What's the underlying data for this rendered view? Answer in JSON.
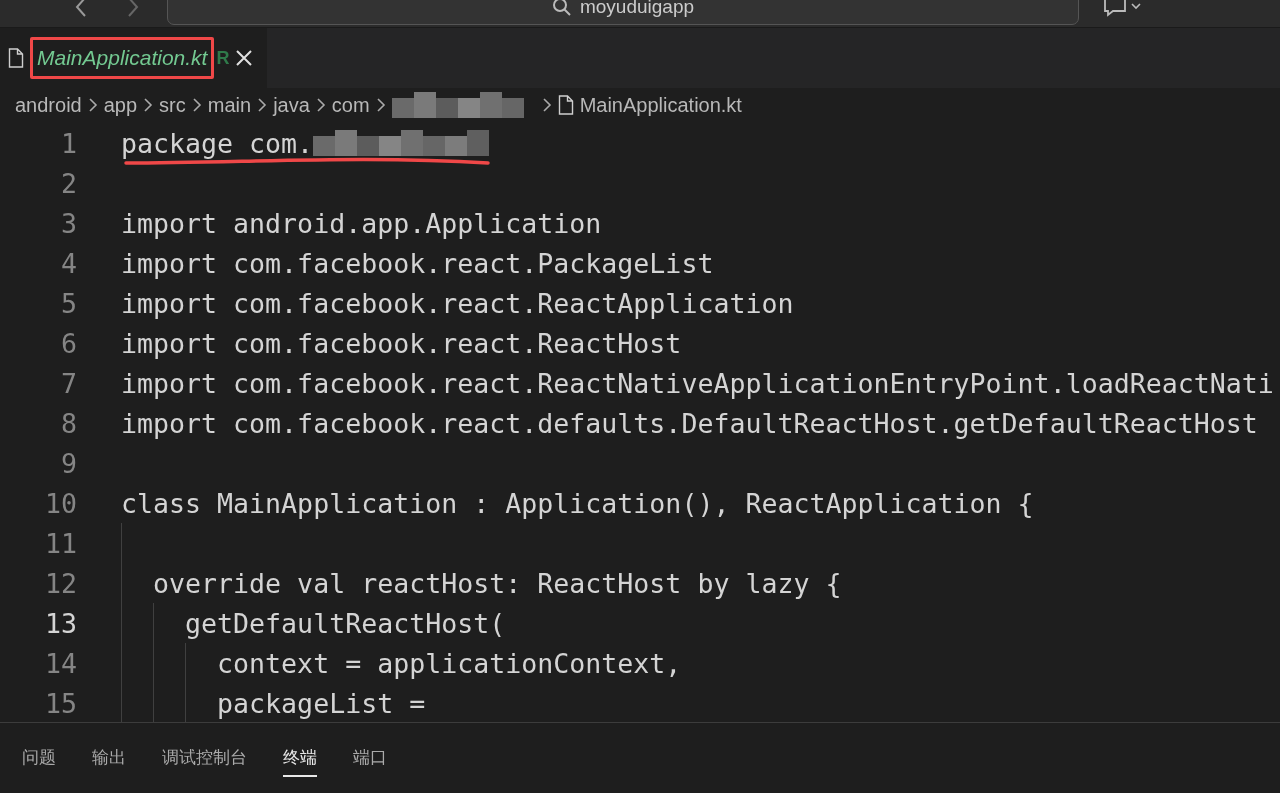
{
  "title_bar": {
    "search": "moyuduigapp"
  },
  "tabs": [
    {
      "label": "MainApplication.kt",
      "git_status": "R",
      "selected": true,
      "highlighted": true
    }
  ],
  "breadcrumb": [
    {
      "label": "android"
    },
    {
      "label": "app"
    },
    {
      "label": "src"
    },
    {
      "label": "main"
    },
    {
      "label": "java"
    },
    {
      "label": "com"
    },
    {
      "redacted": true
    },
    {
      "label": "MainApplication.kt",
      "file": true
    }
  ],
  "code_lines": [
    {
      "number": "1",
      "text": "package com.",
      "redacted": true,
      "underlined": true,
      "current": false
    },
    {
      "number": "2",
      "current": false
    },
    {
      "number": "3",
      "text": "import android.app.Application",
      "current": false
    },
    {
      "number": "4",
      "text": "import com.facebook.react.PackageList",
      "current": false
    },
    {
      "number": "5",
      "text": "import com.facebook.react.ReactApplication",
      "current": false
    },
    {
      "number": "6",
      "text": "import com.facebook.react.ReactHost",
      "current": false
    },
    {
      "number": "7",
      "text": "import com.facebook.react.ReactNativeApplicationEntryPoint.loadReactNati",
      "current": false
    },
    {
      "number": "8",
      "text": "import com.facebook.react.defaults.DefaultReactHost.getDefaultReactHost",
      "current": false
    },
    {
      "number": "9",
      "current": false
    },
    {
      "number": "10",
      "text": "class MainApplication : Application(), ReactApplication {",
      "current": false
    },
    {
      "number": "11",
      "current": false
    },
    {
      "number": "12",
      "text": "  override val reactHost: ReactHost by lazy {",
      "current": false
    },
    {
      "number": "13",
      "text": "    getDefaultReactHost(",
      "current": true
    },
    {
      "number": "14",
      "text": "      context = applicationContext,",
      "current": false
    },
    {
      "number": "15",
      "text": "      packageList =",
      "current": false
    }
  ],
  "panel_tabs": [
    {
      "label": "问题",
      "selected": false
    },
    {
      "label": "输出",
      "selected": false
    },
    {
      "label": "调试控制台",
      "selected": false
    },
    {
      "label": "终端",
      "selected": true
    },
    {
      "label": "端口",
      "selected": false
    }
  ]
}
